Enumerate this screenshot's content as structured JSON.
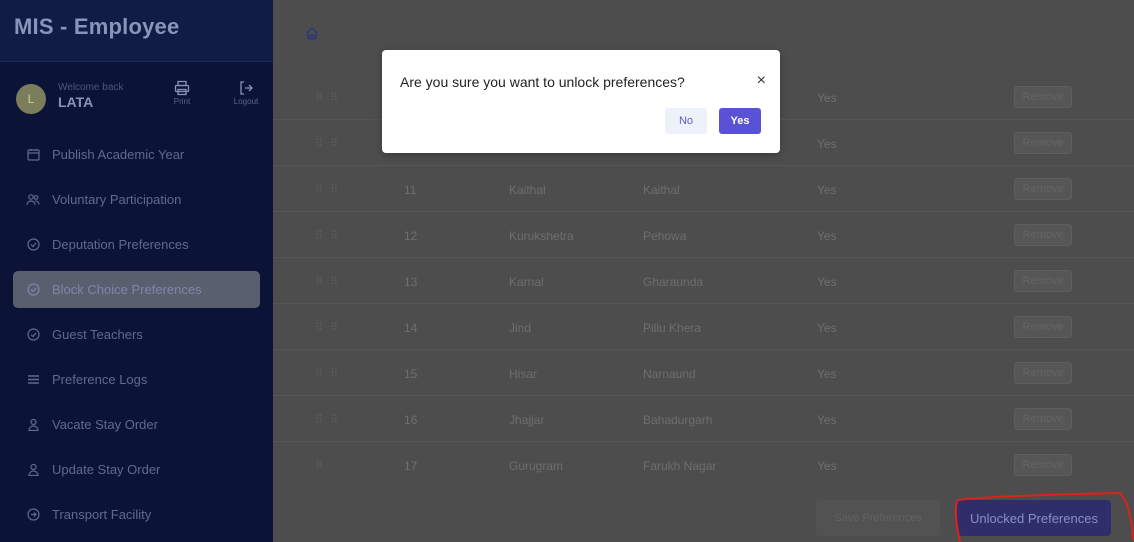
{
  "sidebar": {
    "title": "MIS - Employee",
    "user": {
      "avatar_initial": "L",
      "welcome": "Welcome back",
      "name": "LATA"
    },
    "tools": {
      "print": "Print",
      "logout": "Logout"
    },
    "items": [
      {
        "label": "Publish Academic Year",
        "icon": "calendar-icon"
      },
      {
        "label": "Voluntary Participation",
        "icon": "users-icon"
      },
      {
        "label": "Deputation Preferences",
        "icon": "check-circle-icon"
      },
      {
        "label": "Block Choice Preferences",
        "icon": "check-circle-icon",
        "active": true
      },
      {
        "label": "Guest Teachers",
        "icon": "check-circle-icon"
      },
      {
        "label": "Preference Logs",
        "icon": "list-icon"
      },
      {
        "label": "Vacate Stay Order",
        "icon": "user-icon"
      },
      {
        "label": "Update Stay Order",
        "icon": "user-icon"
      },
      {
        "label": "Transport Facility",
        "icon": "circle-arrow-icon"
      }
    ]
  },
  "table": {
    "rows": [
      {
        "sno": "",
        "district": "",
        "block": "",
        "status": "Yes",
        "action": "Remove"
      },
      {
        "sno": "",
        "district": "",
        "block": "",
        "status": "Yes",
        "action": "Remove"
      },
      {
        "sno": "11",
        "district": "Kaithal",
        "block": "Kaithal",
        "status": "Yes",
        "action": "Remove"
      },
      {
        "sno": "12",
        "district": "Kurukshetra",
        "block": "Pehowa",
        "status": "Yes",
        "action": "Remove"
      },
      {
        "sno": "13",
        "district": "Karnal",
        "block": "Gharaunda",
        "status": "Yes",
        "action": "Remove"
      },
      {
        "sno": "14",
        "district": "Jind",
        "block": "Pillu Khera",
        "status": "Yes",
        "action": "Remove"
      },
      {
        "sno": "15",
        "district": "Hisar",
        "block": "Narnaund",
        "status": "Yes",
        "action": "Remove"
      },
      {
        "sno": "16",
        "district": "Jhajjar",
        "block": "Bahadurgarh",
        "status": "Yes",
        "action": "Remove"
      },
      {
        "sno": "17",
        "district": "Gurugram",
        "block": "Farukh Nagar",
        "status": "Yes",
        "action": "Remove"
      }
    ]
  },
  "footer": {
    "save_label": "Save Preferences",
    "unlock_label": "Unlocked Preferences"
  },
  "modal": {
    "message": "Are you sure you want to unlock preferences?",
    "close": "×",
    "no_label": "No",
    "yes_label": "Yes"
  },
  "colors": {
    "sidebar_bg": "#0b1437",
    "primary": "#5a52d5",
    "annotation": "#e0201c"
  }
}
